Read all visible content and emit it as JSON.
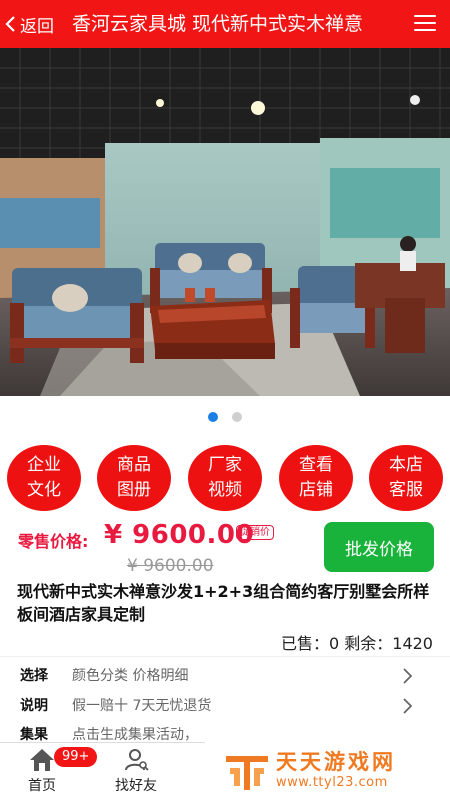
{
  "header": {
    "back_label": "返回",
    "title": "香河云家具城 现代新中式实木禅意"
  },
  "gallery": {
    "total": 2,
    "active_index": 1
  },
  "colors": {
    "brand_red": "#f21515",
    "price_red": "#e81a40",
    "wholesale_green": "#19b33b",
    "dot_active": "#1a7ee6"
  },
  "quick_links": [
    {
      "label": "企业文化"
    },
    {
      "label": "商品图册"
    },
    {
      "label": "厂家视频"
    },
    {
      "label": "查看店铺"
    },
    {
      "label": "本店客服"
    }
  ],
  "price": {
    "label": "零售价格:",
    "value": "¥ 9600.00",
    "promo_tag": "促销价",
    "original": "¥ 9600.00",
    "wholesale_button": "批发价格"
  },
  "product": {
    "name": "现代新中式实木禅意沙发1+2+3组合简约客厅别墅会所样板间酒店家具定制",
    "stock": "已售：0 剩余：1420"
  },
  "options": [
    {
      "label": "选择",
      "value": "颜色分类 价格明细"
    },
    {
      "label": "说明",
      "value": "假一赔十 7天无忧退货"
    },
    {
      "label": "集果",
      "value": "点击生成集果活动，"
    }
  ],
  "bottom_nav": {
    "home_label": "首页",
    "friends_label": "找好友",
    "badge": "99+"
  },
  "watermark": {
    "title": "天天游戏网",
    "url": "www.ttyl23.com"
  }
}
